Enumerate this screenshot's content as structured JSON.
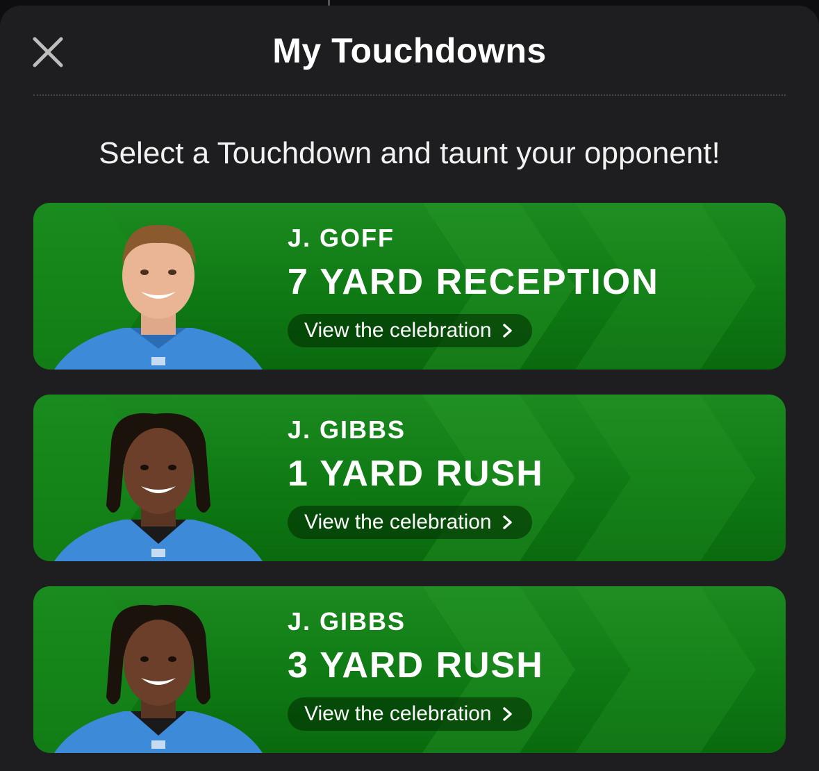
{
  "header": {
    "title": "My Touchdowns",
    "close_icon": "close-icon"
  },
  "subtitle": "Select a Touchdown and taunt your opponent!",
  "colors": {
    "card_green": "#138016",
    "background": "#1e1e20",
    "jersey_blue": "#3d8bd8"
  },
  "touchdowns": [
    {
      "player": "J. GOFF",
      "play": "7 YARD RECEPTION",
      "cta": "View the celebration"
    },
    {
      "player": "J. GIBBS",
      "play": "1 YARD RUSH",
      "cta": "View the celebration"
    },
    {
      "player": "J. GIBBS",
      "play": "3 YARD RUSH",
      "cta": "View the celebration"
    }
  ]
}
